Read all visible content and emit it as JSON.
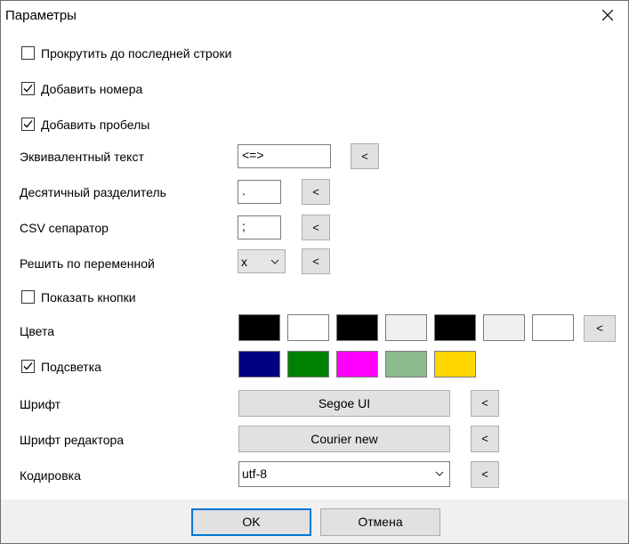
{
  "window": {
    "title": "Параметры"
  },
  "options": {
    "scroll_last_label": "Прокрутить до последней строки",
    "scroll_last_checked": false,
    "add_numbers_label": "Добавить номера",
    "add_numbers_checked": true,
    "add_spaces_label": "Добавить пробелы",
    "add_spaces_checked": true,
    "equiv_text_label": "Эквивалентный текст",
    "equiv_text_value": "<=>",
    "decimal_sep_label": "Десятичный разделитель",
    "decimal_sep_value": ".",
    "csv_sep_label": "CSV сепаратор",
    "csv_sep_value": ";",
    "solve_var_label": "Решить по переменной",
    "solve_var_value": "x",
    "show_buttons_label": "Показать кнопки",
    "show_buttons_checked": false,
    "colors_label": "Цвета",
    "highlight_label": "Подсветка",
    "highlight_checked": true,
    "font_label": "Шрифт",
    "font_value": "Segoe UI",
    "editor_font_label": "Шрифт редактора",
    "editor_font_value": "Courier new",
    "encoding_label": "Кодировка",
    "encoding_value": "utf-8",
    "reset_label": "<"
  },
  "colors": [
    "#000000",
    "#ffffff",
    "#000000",
    "#f0f0f0",
    "#000000",
    "#f0f0f0",
    "#ffffff"
  ],
  "highlight_colors": [
    "#000080",
    "#008000",
    "#ff00ff",
    "#8fbc8f",
    "#ffd700"
  ],
  "footer": {
    "ok_label": "OK",
    "cancel_label": "Отмена"
  }
}
